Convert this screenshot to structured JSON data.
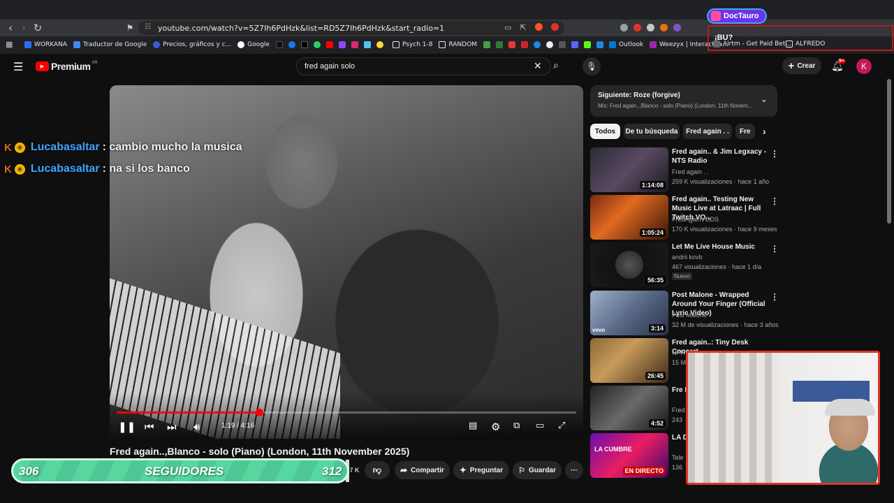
{
  "browser": {
    "url": "youtube.com/watch?v=5Z7Ih6PdHzk&list=RD5Z7Ih6PdHzk&start_radio=1",
    "bookmarks": [
      "WORKANA",
      "Traductor de Google",
      "Precios, gráficos y c...",
      "Google",
      "Psych 1-8",
      "RANDOM",
      "Outlook",
      "Weezyx | Interactúa...",
      "Airtm - Get Paid Bet...",
      "ALFREDO"
    ]
  },
  "overlay": {
    "streamer_name": "DocTauro",
    "alert_text": "¡BU?",
    "chat": [
      {
        "user": "Lucabasaltar",
        "message": ": cambio mucho la musica"
      },
      {
        "user": "Lucabasaltar",
        "message": ": na si los banco"
      }
    ],
    "followers": {
      "current": "306",
      "label": "SEGUIDORES",
      "goal": "312",
      "progress": 0.98
    }
  },
  "youtube": {
    "logo": "Premium",
    "region": "AR",
    "search_query": "fred again solo",
    "create_label": "Crear",
    "notif_count": "9+",
    "avatar_letter": "K",
    "player": {
      "time": "1:19 / 4:16",
      "progress": 0.31
    },
    "title": "Fred again..,Blanco - solo (Piano) (London, 11th November 2025)",
    "likes": "6.7 K",
    "actions": {
      "share": "Compartir",
      "ask": "Preguntar",
      "save": "Guardar"
    },
    "up_next": {
      "label": "Siguiente: Roze (forgive)",
      "mix": "Mix: Fred again..,Blanco - solo (Piano) (London, 11th Novem..."
    },
    "chips": [
      "Todos",
      "De tu búsqueda",
      "Fred again . .",
      "Fre"
    ],
    "videos": [
      {
        "title": "Fred again.. & Jim Legxacy - NTS Radio",
        "channel": "Fred again . .",
        "meta": "259 K visualizaciones · hace 1 año",
        "duration": "1:14:08"
      },
      {
        "title": "Fred again.. Testing New Music Live at Latraac | Full Twitch VO...",
        "channel": "FredAgainVODS",
        "meta": "170 K visualizaciones · hace 9 meses",
        "duration": "1:05:24"
      },
      {
        "title": "Let Me Live House Music",
        "channel": "andrii kovb",
        "meta": "467 visualizaciones · hace 1 día",
        "duration": "56:35",
        "badge": "Nuevo"
      },
      {
        "title": "Post Malone - Wrapped Around Your Finger (Official Lyric Video)",
        "channel": "Post Malone",
        "meta": "32 M de visualizaciones · hace 3 años",
        "duration": "3:14",
        "thumb_text": "vevo"
      },
      {
        "title": "Fred again..: Tiny Desk Concert",
        "channel": "NPR",
        "meta": "15 M",
        "duration": "26:45"
      },
      {
        "title": "Fre Fra",
        "channel": "Fred",
        "meta": "243",
        "duration": "4:52"
      },
      {
        "title": "LA DEL",
        "channel": "Tele",
        "meta": "136",
        "duration": "EN DIRECTO",
        "thumb_text": "LA CUMBRE"
      }
    ]
  }
}
